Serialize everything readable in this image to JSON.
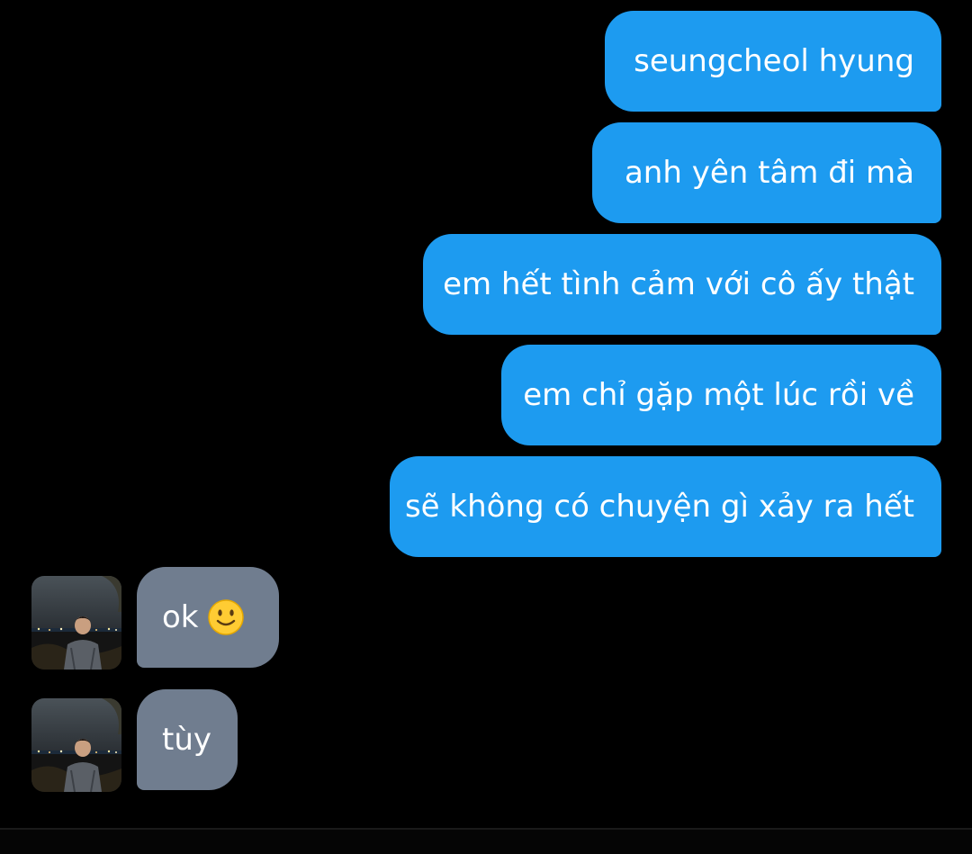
{
  "messages": {
    "outgoing": [
      {
        "text": "seungcheol hyung"
      },
      {
        "text": "anh yên tâm đi mà "
      },
      {
        "text": "em hết tình cảm với cô ấy thật"
      },
      {
        "text": "em chỉ gặp một lúc rồi về"
      },
      {
        "text": "sẽ không có chuyện gì xảy ra hết"
      }
    ],
    "incoming": [
      {
        "text": "ok",
        "icon": "slightly-smiling-face-emoji"
      },
      {
        "text": "tùy"
      }
    ]
  },
  "colors": {
    "background": "#000000",
    "outgoing_bubble": "#1d9bf0",
    "incoming_bubble": "#707d8f",
    "text": "#ffffff"
  }
}
